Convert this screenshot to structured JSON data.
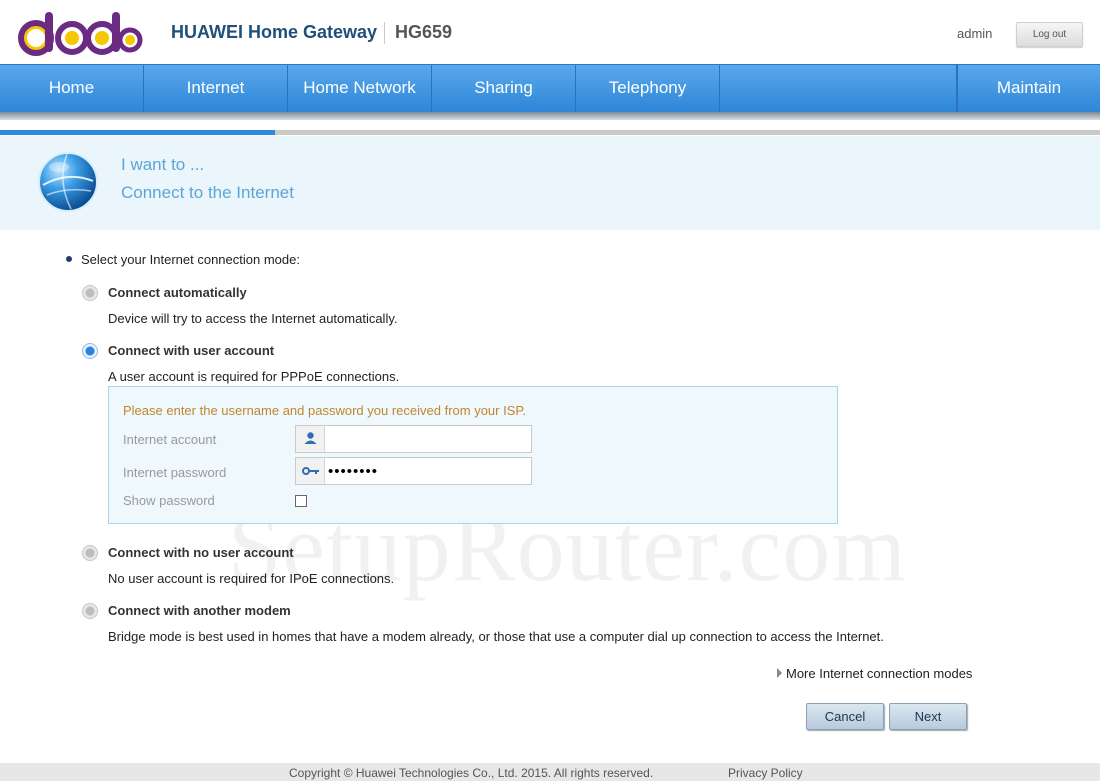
{
  "header": {
    "logo_text": "dodo",
    "brand": "HUAWEI Home Gateway",
    "model": "HG659",
    "user": "admin",
    "logout_label": "Log out"
  },
  "nav": {
    "items": [
      {
        "label": "Home"
      },
      {
        "label": "Internet"
      },
      {
        "label": "Home Network"
      },
      {
        "label": "Sharing"
      },
      {
        "label": "Telephony"
      },
      {
        "label": "Maintain"
      }
    ]
  },
  "progress": {
    "fraction": 0.25
  },
  "banner": {
    "icon": "globe-icon",
    "want": "I want to ...",
    "goal": "Connect to the Internet"
  },
  "content": {
    "prompt": "Select your Internet connection mode:",
    "options": [
      {
        "title": "Connect automatically",
        "desc": "Device will try to access the Internet automatically.",
        "checked": false
      },
      {
        "title": "Connect with user account",
        "desc": "A user account is required for PPPoE connections.",
        "checked": true
      },
      {
        "title": "Connect with no user account",
        "desc": "No user account is required for IPoE connections.",
        "checked": false
      },
      {
        "title": "Connect with another modem",
        "desc": "Bridge mode is best used in homes that have a modem already, or those that use a computer dial up connection to access the Internet.",
        "checked": false
      }
    ],
    "form": {
      "hint": "Please enter the username and password you received from your ISP.",
      "account_label": "Internet account",
      "account_value": "",
      "password_label": "Internet password",
      "password_value": "••••••••",
      "show_password_label": "Show password",
      "show_password_checked": false
    },
    "more_link": "More Internet connection modes",
    "cancel_label": "Cancel",
    "next_label": "Next"
  },
  "watermark": "SetupRouter.com",
  "footer": {
    "copyright": "Copyright © Huawei Technologies Co., Ltd. 2015. All rights reserved.",
    "privacy": "Privacy Policy"
  },
  "colors": {
    "nav_blue": "#2e86d7",
    "banner_text": "#5ba6d6",
    "hint_orange": "#c0862d",
    "logo_purple": "#6b2b82",
    "logo_yellow": "#f6c800"
  }
}
